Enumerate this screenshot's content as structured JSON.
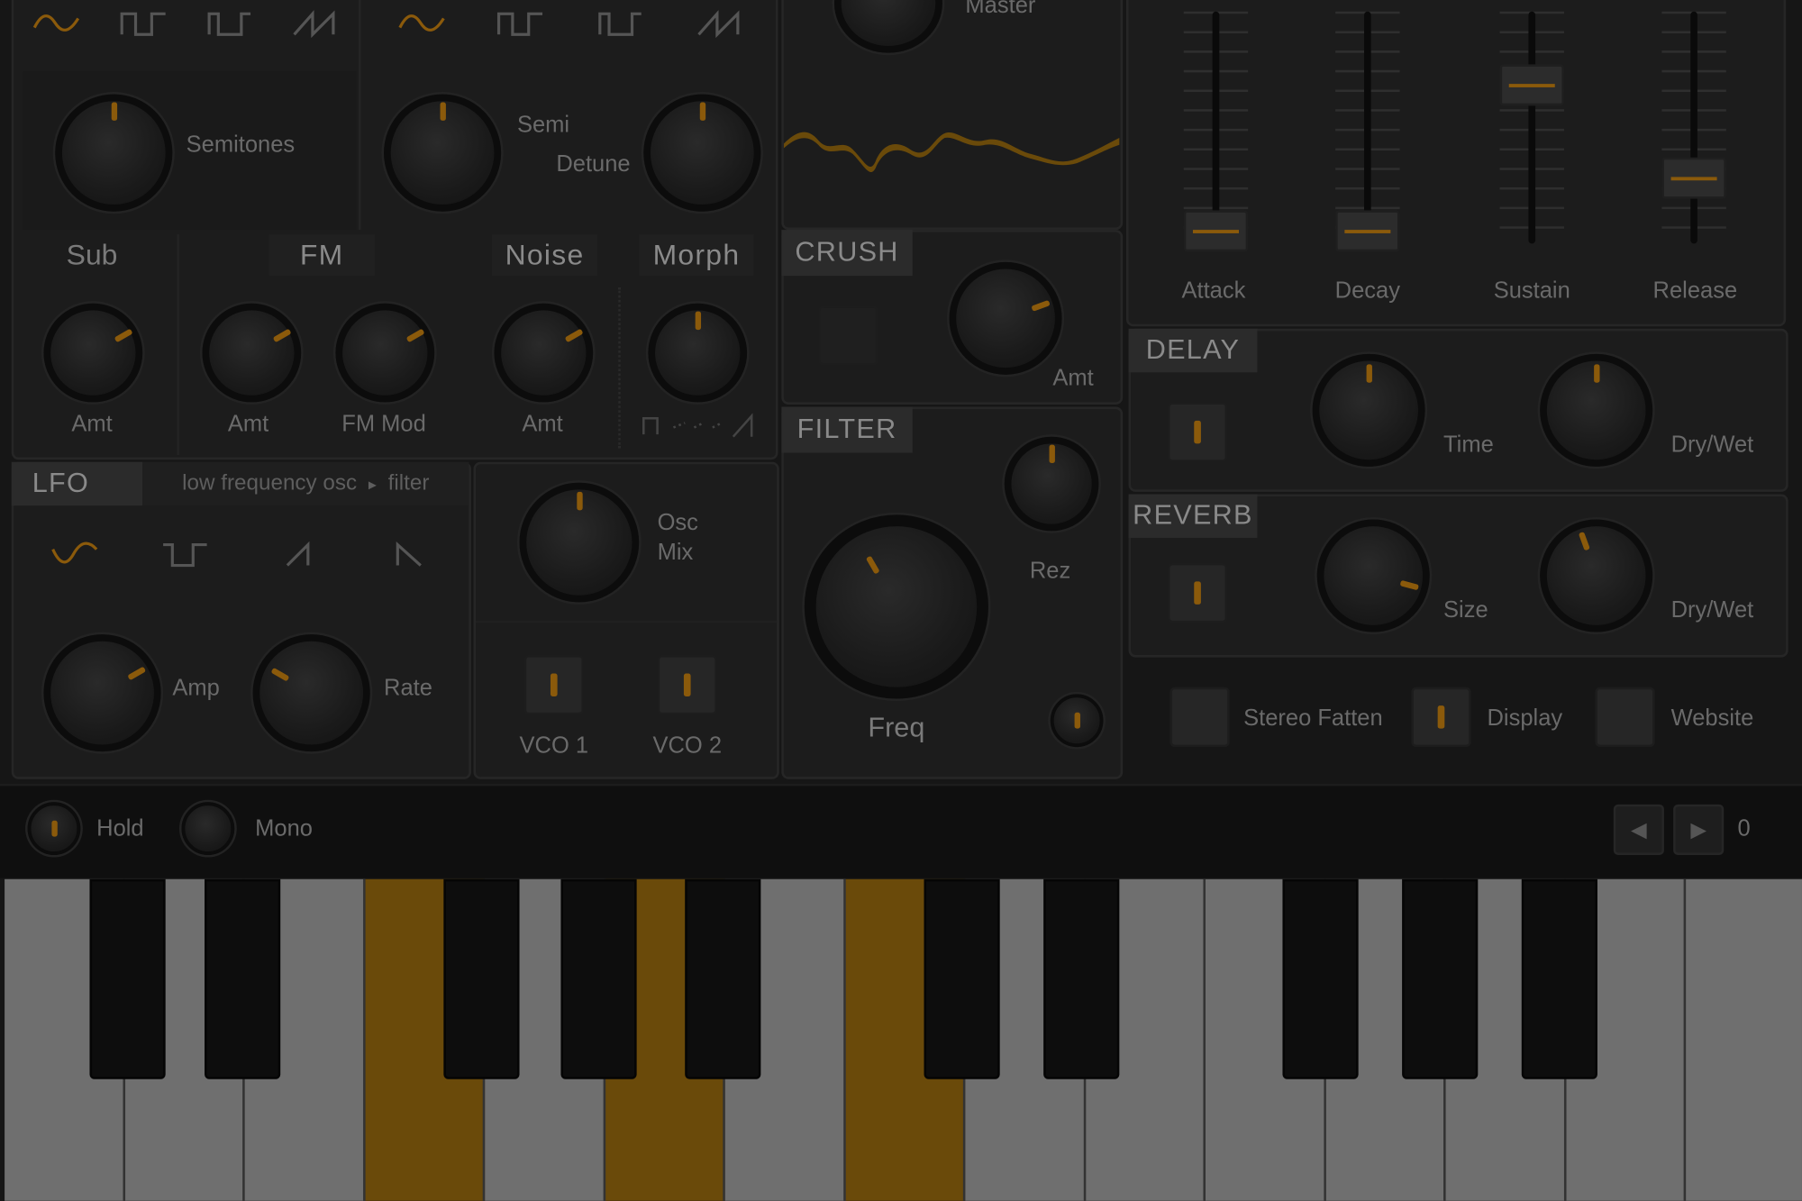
{
  "accent_color": "#8b5a0b",
  "osc": {
    "osc1_waveforms": [
      "sine-wave-icon",
      "square-wave-icon",
      "pulse-wave-icon",
      "saw-wave-icon"
    ],
    "osc2_waveforms": [
      "sine-wave-icon",
      "square-wave-icon",
      "pulse-wave-icon",
      "saw-wave-icon"
    ],
    "semitones_label": "Semitones",
    "semi_label": "Semi",
    "detune_label": "Detune"
  },
  "mix": {
    "sub_title": "Sub",
    "fm_title": "FM",
    "noise_title": "Noise",
    "morph_title": "Morph",
    "sub_amt": "Amt",
    "fm_amt": "Amt",
    "fm_mod": "FM Mod",
    "noise_amt": "Amt"
  },
  "master": {
    "label": "Master"
  },
  "crush": {
    "title": "CRUSH",
    "amt_label": "Amt"
  },
  "filter": {
    "title": "FILTER",
    "rez_label": "Rez",
    "freq_label": "Freq"
  },
  "envelope": {
    "attack": "Attack",
    "decay": "Decay",
    "sustain": "Sustain",
    "release": "Release",
    "levels": {
      "attack": 0.05,
      "decay": 0.05,
      "sustain": 0.75,
      "release": 0.3
    }
  },
  "delay": {
    "title": "DELAY",
    "time_label": "Time",
    "drywet_label": "Dry/Wet"
  },
  "reverb": {
    "title": "REVERB",
    "size_label": "Size",
    "drywet_label": "Dry/Wet"
  },
  "lfo": {
    "title": "LFO",
    "routing_from": "low frequency osc",
    "routing_arrow": "▸",
    "routing_to": "filter",
    "amp_label": "Amp",
    "rate_label": "Rate"
  },
  "oscmix": {
    "label_line1": "Osc",
    "label_line2": "Mix",
    "vco1": "VCO 1",
    "vco2": "VCO 2"
  },
  "toggles": {
    "stereo": "Stereo Fatten",
    "display": "Display",
    "website": "Website"
  },
  "bottom": {
    "hold": "Hold",
    "mono": "Mono",
    "octave": "0",
    "prev": "◀",
    "next": "▶"
  }
}
